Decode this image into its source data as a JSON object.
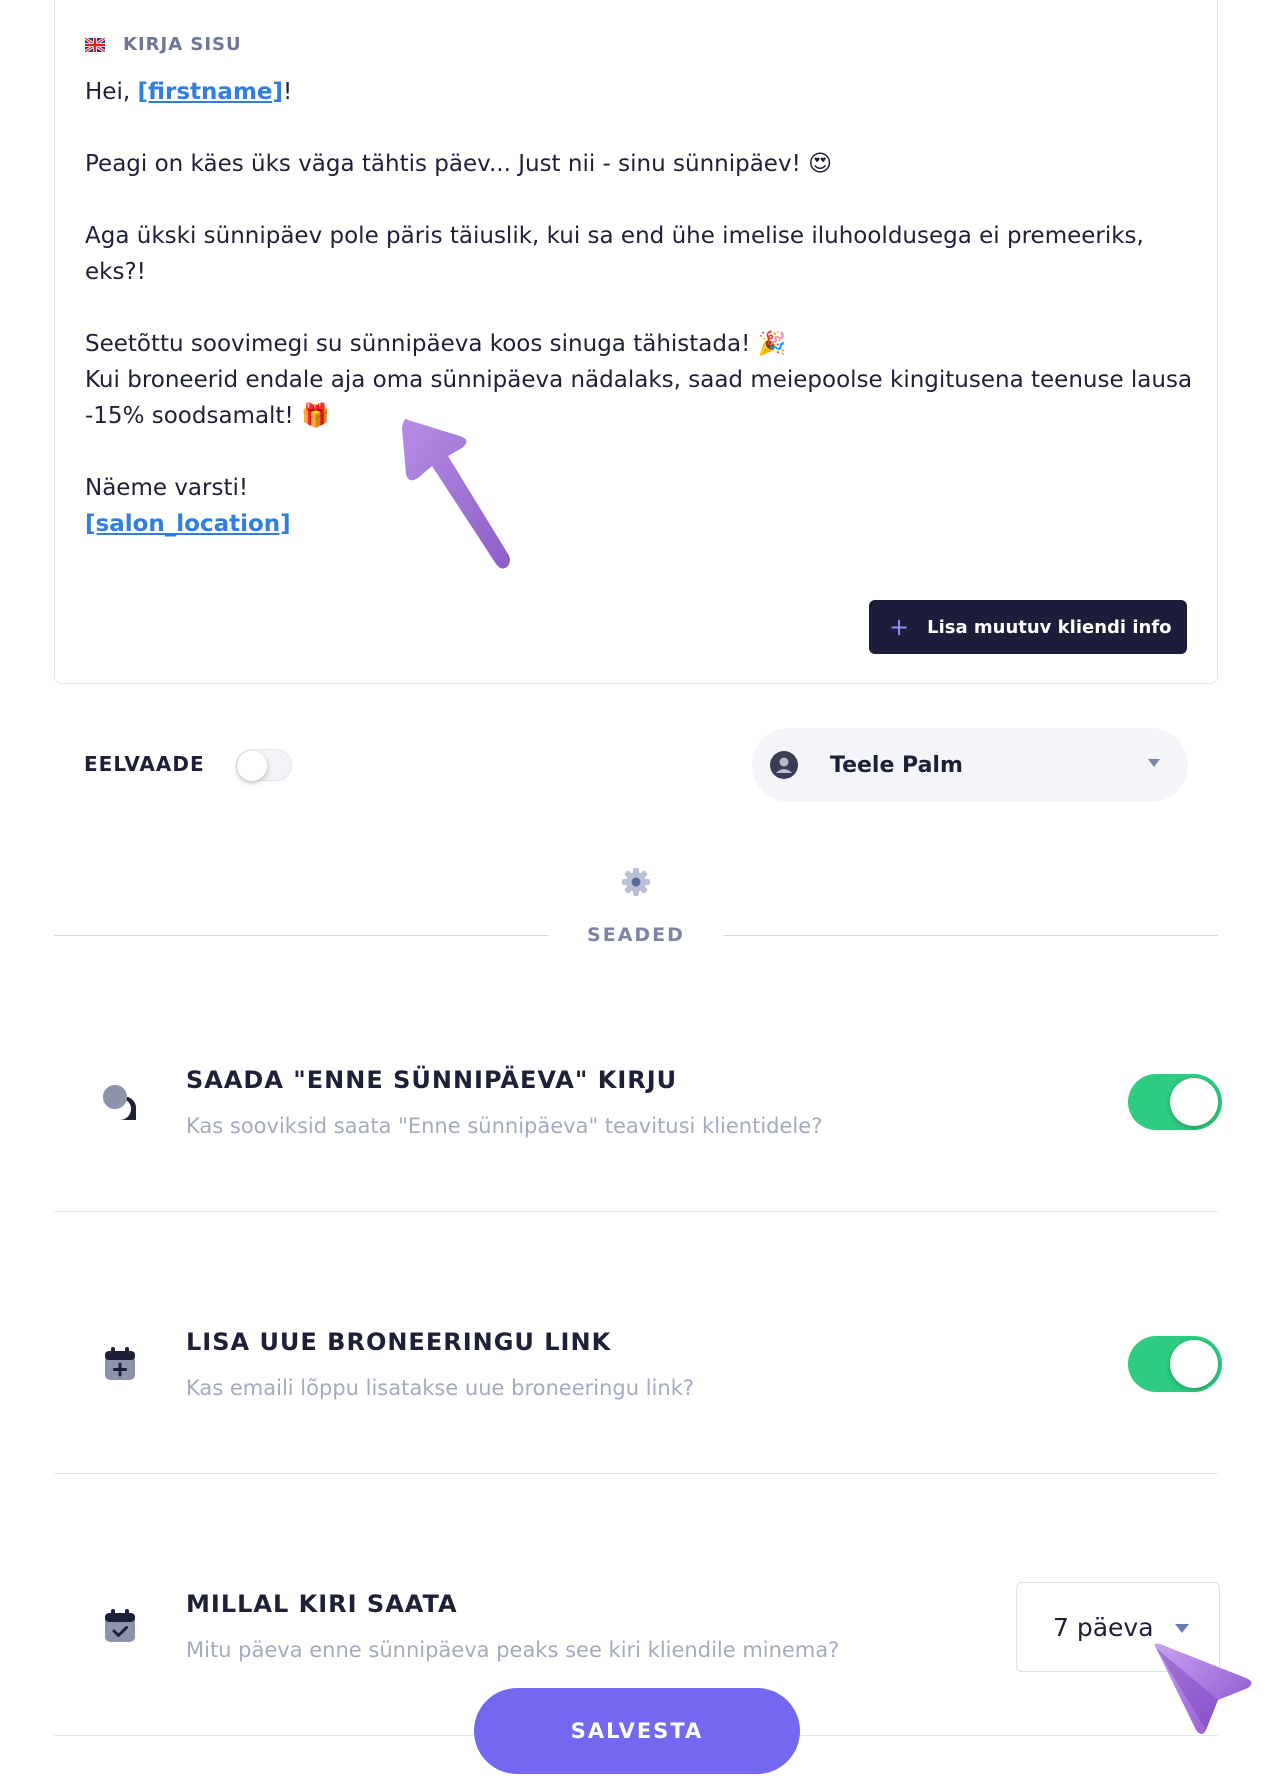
{
  "letter": {
    "header_label": "KIRJA SISU",
    "greeting_prefix": "Hei, ",
    "var_firstname": "[firstname]",
    "greeting_suffix": "!",
    "line1": "Peagi on käes üks väga tähtis päev... Just nii - sinu sünnipäev! 😍",
    "line2": "Aga ükski sünnipäev pole päris täiuslik, kui sa end ühe imelise iluhooldusega ei premeeriks, eks?!",
    "line3": "Seetõttu soovimegi su sünnipäeva koos sinuga tähistada! 🎉",
    "line4": "Kui broneerid endale aja oma sünnipäeva nädalaks, saad meiepoolse kingitusena teenuse lausa -15% soodsamalt! 🎁",
    "line5": "Näeme varsti!",
    "var_salon_location": "[salon_location]",
    "add_variable_button": "Lisa muutuv kliendi info"
  },
  "preview": {
    "label": "EELVAADE",
    "enabled": false,
    "client_name": "Teele Palm"
  },
  "settings": {
    "section_label": "SEADED",
    "rows": [
      {
        "title": "SAADA \"ENNE SÜNNIPÄEVA\" KIRJU",
        "description": "Kas sooviksid saata \"Enne sünnipäeva\" teavitusi klientidele?",
        "icon": "chat-bubbles-icon",
        "enabled": true
      },
      {
        "title": "LISA UUE BRONEERINGU LINK",
        "description": "Kas emaili lõppu lisatakse uue broneeringu link?",
        "icon": "calendar-plus-icon",
        "enabled": true
      },
      {
        "title": "MILLAL KIRI SAATA",
        "description": "Mitu päeva enne sünnipäeva peaks see kiri kliendile minema?",
        "icon": "calendar-check-icon",
        "selected_value": "7 päeva"
      }
    ]
  },
  "save_button": "SALVESTA",
  "colors": {
    "toggle_on": "#2ecc80",
    "primary_button": "#7468f0",
    "dark_button": "#1b1d3a",
    "link": "#2f7fe0",
    "annotation_arrow": "#a77ad9"
  }
}
